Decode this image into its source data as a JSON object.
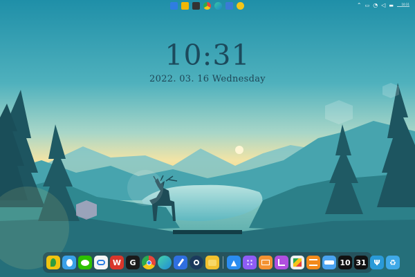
{
  "lock_screen": {
    "time": "10:31",
    "date": "2022. 03. 16  Wednesday"
  },
  "topbar": {
    "apps": [
      {
        "icon": "folder-icon",
        "color": "#2f7de1"
      },
      {
        "icon": "files-icon",
        "color": "#f2b705"
      },
      {
        "icon": "terminal-icon",
        "color": "#333333"
      },
      {
        "icon": "chrome-icon",
        "color": "#e8453c"
      },
      {
        "icon": "edge-icon",
        "color": "#1e88c9"
      },
      {
        "icon": "pen-icon",
        "color": "#3a7bd5"
      },
      {
        "icon": "face-icon",
        "color": "#f5c518"
      }
    ]
  },
  "dock": {
    "left_items": [
      {
        "icon": "leaf-icon",
        "glyph": "",
        "color": "#f1c40f"
      },
      {
        "icon": "qq-icon",
        "glyph": "",
        "color": "#3aa0e8"
      },
      {
        "icon": "wechat-icon",
        "glyph": "",
        "color": "#2dc100"
      },
      {
        "icon": "baidu-netdisk-icon",
        "glyph": "",
        "color": "#f5f5f5"
      },
      {
        "icon": "wps-icon",
        "glyph": "W",
        "color": "#d9362b"
      },
      {
        "icon": "grammar-icon",
        "glyph": "G",
        "color": "#1a1a1a"
      },
      {
        "icon": "chrome-icon",
        "glyph": "",
        "color": "#ffffff"
      },
      {
        "icon": "edge-icon",
        "glyph": "",
        "color": "#1f8bd8"
      },
      {
        "icon": "pen-icon",
        "glyph": "",
        "color": "#2f6fe0"
      },
      {
        "icon": "steam-icon",
        "glyph": "",
        "color": "#1b3a5c"
      },
      {
        "icon": "folder-icon",
        "glyph": "",
        "color": "#f2c12e"
      }
    ],
    "right_items": [
      {
        "icon": "app-store-icon",
        "glyph": "",
        "color": "#2b8cf0"
      },
      {
        "icon": "launchpad-icon",
        "glyph": "",
        "color": "#8e5cf5"
      },
      {
        "icon": "mail-icon",
        "glyph": "",
        "color": "#f39232"
      },
      {
        "icon": "crop-icon",
        "glyph": "",
        "color": "#b04fe0"
      },
      {
        "icon": "photos-icon",
        "glyph": "",
        "color": "#f0f0f0"
      },
      {
        "icon": "notes-icon",
        "glyph": "",
        "color": "#f28a1c"
      },
      {
        "icon": "finder-icon",
        "glyph": "",
        "color": "#4aa3f0"
      }
    ],
    "number_items": [
      {
        "icon": "clock-widget-icon",
        "glyph": "10"
      },
      {
        "icon": "calendar-icon",
        "glyph": "31"
      }
    ],
    "tail_items": [
      {
        "icon": "usb-icon",
        "glyph": "",
        "color": "#2a9ad8"
      },
      {
        "icon": "recycle-bin-icon",
        "glyph": "",
        "color": "#3fa9e8"
      }
    ]
  }
}
